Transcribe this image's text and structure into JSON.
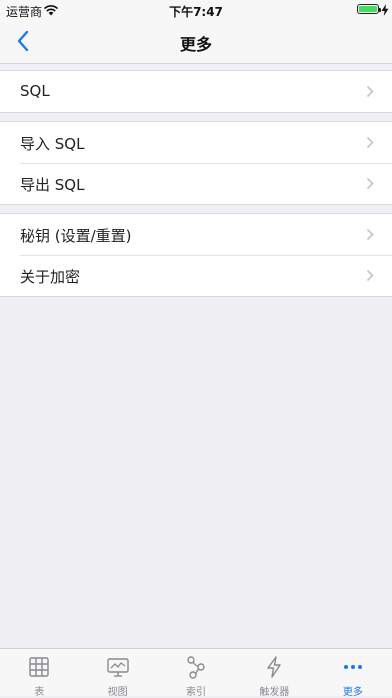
{
  "status_bar": {
    "carrier": "运营商",
    "time": "下午7:47"
  },
  "nav": {
    "title": "更多"
  },
  "groups": [
    {
      "items": [
        {
          "label": "SQL"
        }
      ]
    },
    {
      "items": [
        {
          "label": "导入 SQL"
        },
        {
          "label": "导出 SQL"
        }
      ]
    },
    {
      "items": [
        {
          "label": "秘钥 (设置/重置)"
        },
        {
          "label": "关于加密"
        }
      ]
    }
  ],
  "tabs": [
    {
      "label": "表",
      "icon": "table-icon"
    },
    {
      "label": "视图",
      "icon": "monitor-icon"
    },
    {
      "label": "索引",
      "icon": "index-icon"
    },
    {
      "label": "触发器",
      "icon": "lightning-icon"
    },
    {
      "label": "更多",
      "icon": "more-dots-icon",
      "active": true
    }
  ],
  "colors": {
    "accent": "#1a7be0",
    "background": "#efeff4",
    "battery": "#4cd964"
  }
}
